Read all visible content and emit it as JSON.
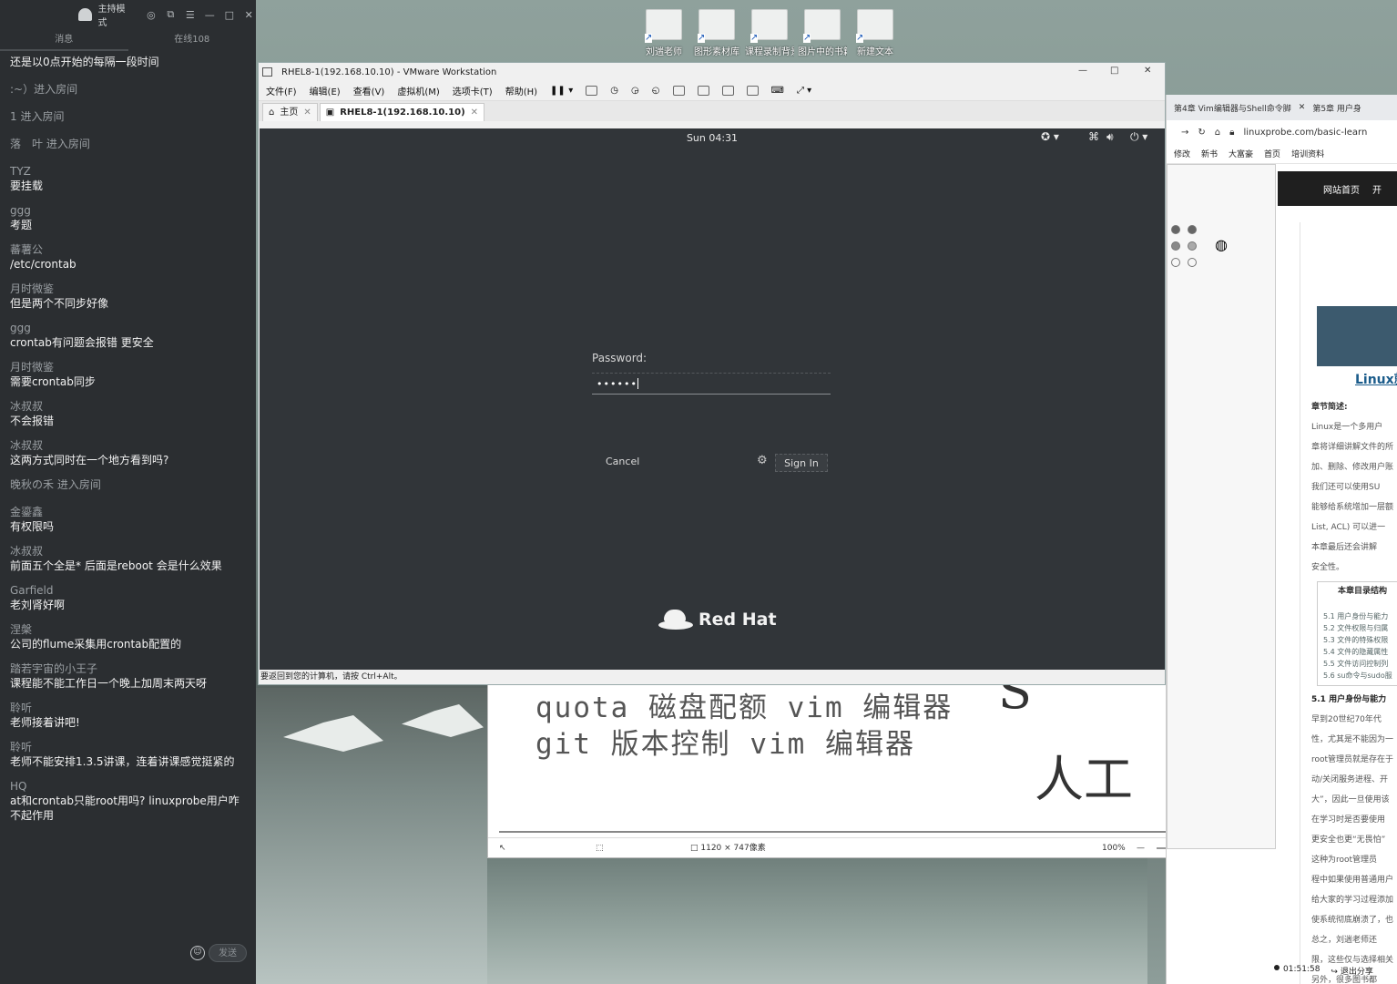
{
  "chat": {
    "mode_label": "主持模式",
    "tabs": [
      "消息",
      "在线108"
    ],
    "system_lines": [
      "还是以0点开始的每隔一段时间",
      ":~）进入房间",
      "1 进入房间",
      "落　叶 进入房间"
    ],
    "messages": [
      {
        "who": "TYZ",
        "text": "要挂载"
      },
      {
        "who": "ggg",
        "text": "考题"
      },
      {
        "who": "蕃薯公",
        "text": "/etc/crontab"
      },
      {
        "who": "月时微鉴",
        "text": "但是两个不同步好像"
      },
      {
        "who": "ggg",
        "text": "crontab有问题会报错  更安全"
      },
      {
        "who": "月时微鉴",
        "text": "需要crontab同步"
      },
      {
        "who": "冰叔叔",
        "text": "不会报错"
      },
      {
        "who": "冰叔叔",
        "text": "这两方式同时在一个地方看到吗?"
      },
      {
        "who": "",
        "text": "晚秋の禾 进入房间",
        "system": true
      },
      {
        "who": "金鎏鑫",
        "text": "有权限吗"
      },
      {
        "who": "冰叔叔",
        "text": "前面五个全是*  后面是reboot  会是什么效果"
      },
      {
        "who": "Garfield",
        "text": "老刘肾好啊"
      },
      {
        "who": "涅槃",
        "text": "公司的flume采集用crontab配置的"
      },
      {
        "who": "踏若宇宙的小王子",
        "text": "课程能不能工作日一个晚上加周末两天呀"
      },
      {
        "who": "聆听",
        "text": "老师接着讲吧!"
      },
      {
        "who": "聆听",
        "text": "老师不能安排1.3.5讲课，连着讲课感觉挺紧的"
      },
      {
        "who": "HQ",
        "text": "at和crontab只能root用吗? linuxprobe用户咋不起作用"
      }
    ],
    "send_label": "发送"
  },
  "desktop_icons": [
    "刘遄老师",
    "图形素材库",
    "课程录制背景",
    "图片中的书籍",
    "新建文本"
  ],
  "vmware": {
    "title": "RHEL8-1(192.168.10.10) - VMware Workstation",
    "menu": [
      "文件(F)",
      "编辑(E)",
      "查看(V)",
      "虚拟机(M)",
      "选项卡(T)",
      "帮助(H)"
    ],
    "tabs": [
      {
        "label": "主页"
      },
      {
        "label": "RHEL8-1(192.168.10.10)"
      }
    ],
    "status_text": "要返回到您的计算机，请按 Ctrl+Alt。",
    "guest": {
      "clock": "Sun 04:31",
      "password_label": "Password:",
      "password_value": "••••••",
      "cancel_label": "Cancel",
      "signin_label": "Sign In",
      "brand": "Red Hat"
    }
  },
  "viewer": {
    "line1": "quota 磁盘配额 vim 编辑器",
    "line2": "git 版本控制 vim 编辑器",
    "size_info": "1120 × 747像素",
    "zoom": "100%"
  },
  "browser": {
    "tabs": [
      "第4章 Vim编辑器与Shell命令脚",
      "第5章 用户身"
    ],
    "url": "linuxprobe.com/basic-learn",
    "bookmarks": [
      "修改",
      "新书",
      "大富豪",
      "首页",
      "培训资料"
    ],
    "nav": [
      "网站首页",
      "开"
    ],
    "article": {
      "card_title": "Linux就",
      "intro_label": "章节简述:",
      "paragraphs": [
        "Linux是一个多用户",
        "章将详细讲解文件的所",
        "加、删除、修改用户账",
        "我们还可以使用SU",
        "能够给系统增加一层额",
        "List, ACL) 可以进一",
        "本章最后还会讲解",
        "安全性。"
      ],
      "toc_title": "本章目录结构",
      "toc": [
        "5.1 用户身份与能力",
        "5.2 文件权限与归属",
        "5.3 文件的特殊权限",
        "5.4 文件的隐藏属性",
        "5.5 文件访问控制列",
        "5.6 su命令与sudo服"
      ],
      "section": "5.1 用户身份与能力",
      "body": [
        "早到20世纪70年代",
        "性，尤其是不能因为一",
        "root管理员就是存在于",
        "动/关闭服务进程、开",
        "大”，因此一旦使用该",
        "在学习时是否要使用",
        "更安全也更“无畏怕”",
        "这种为root管理员",
        "程中如果使用普通用户",
        "给大家的学习过程添加",
        "使系统彻底崩溃了，也",
        "总之，刘遄老师还",
        "限，这些仅与选择相关",
        "另外，很多图书都"
      ]
    },
    "footer_time": "01:51:58",
    "footer_exit": "退出分享"
  },
  "colors": {
    "chat_bg": "#2b2e31",
    "guest_bg": "#313539",
    "accent_blue": "#1b5c8b"
  }
}
